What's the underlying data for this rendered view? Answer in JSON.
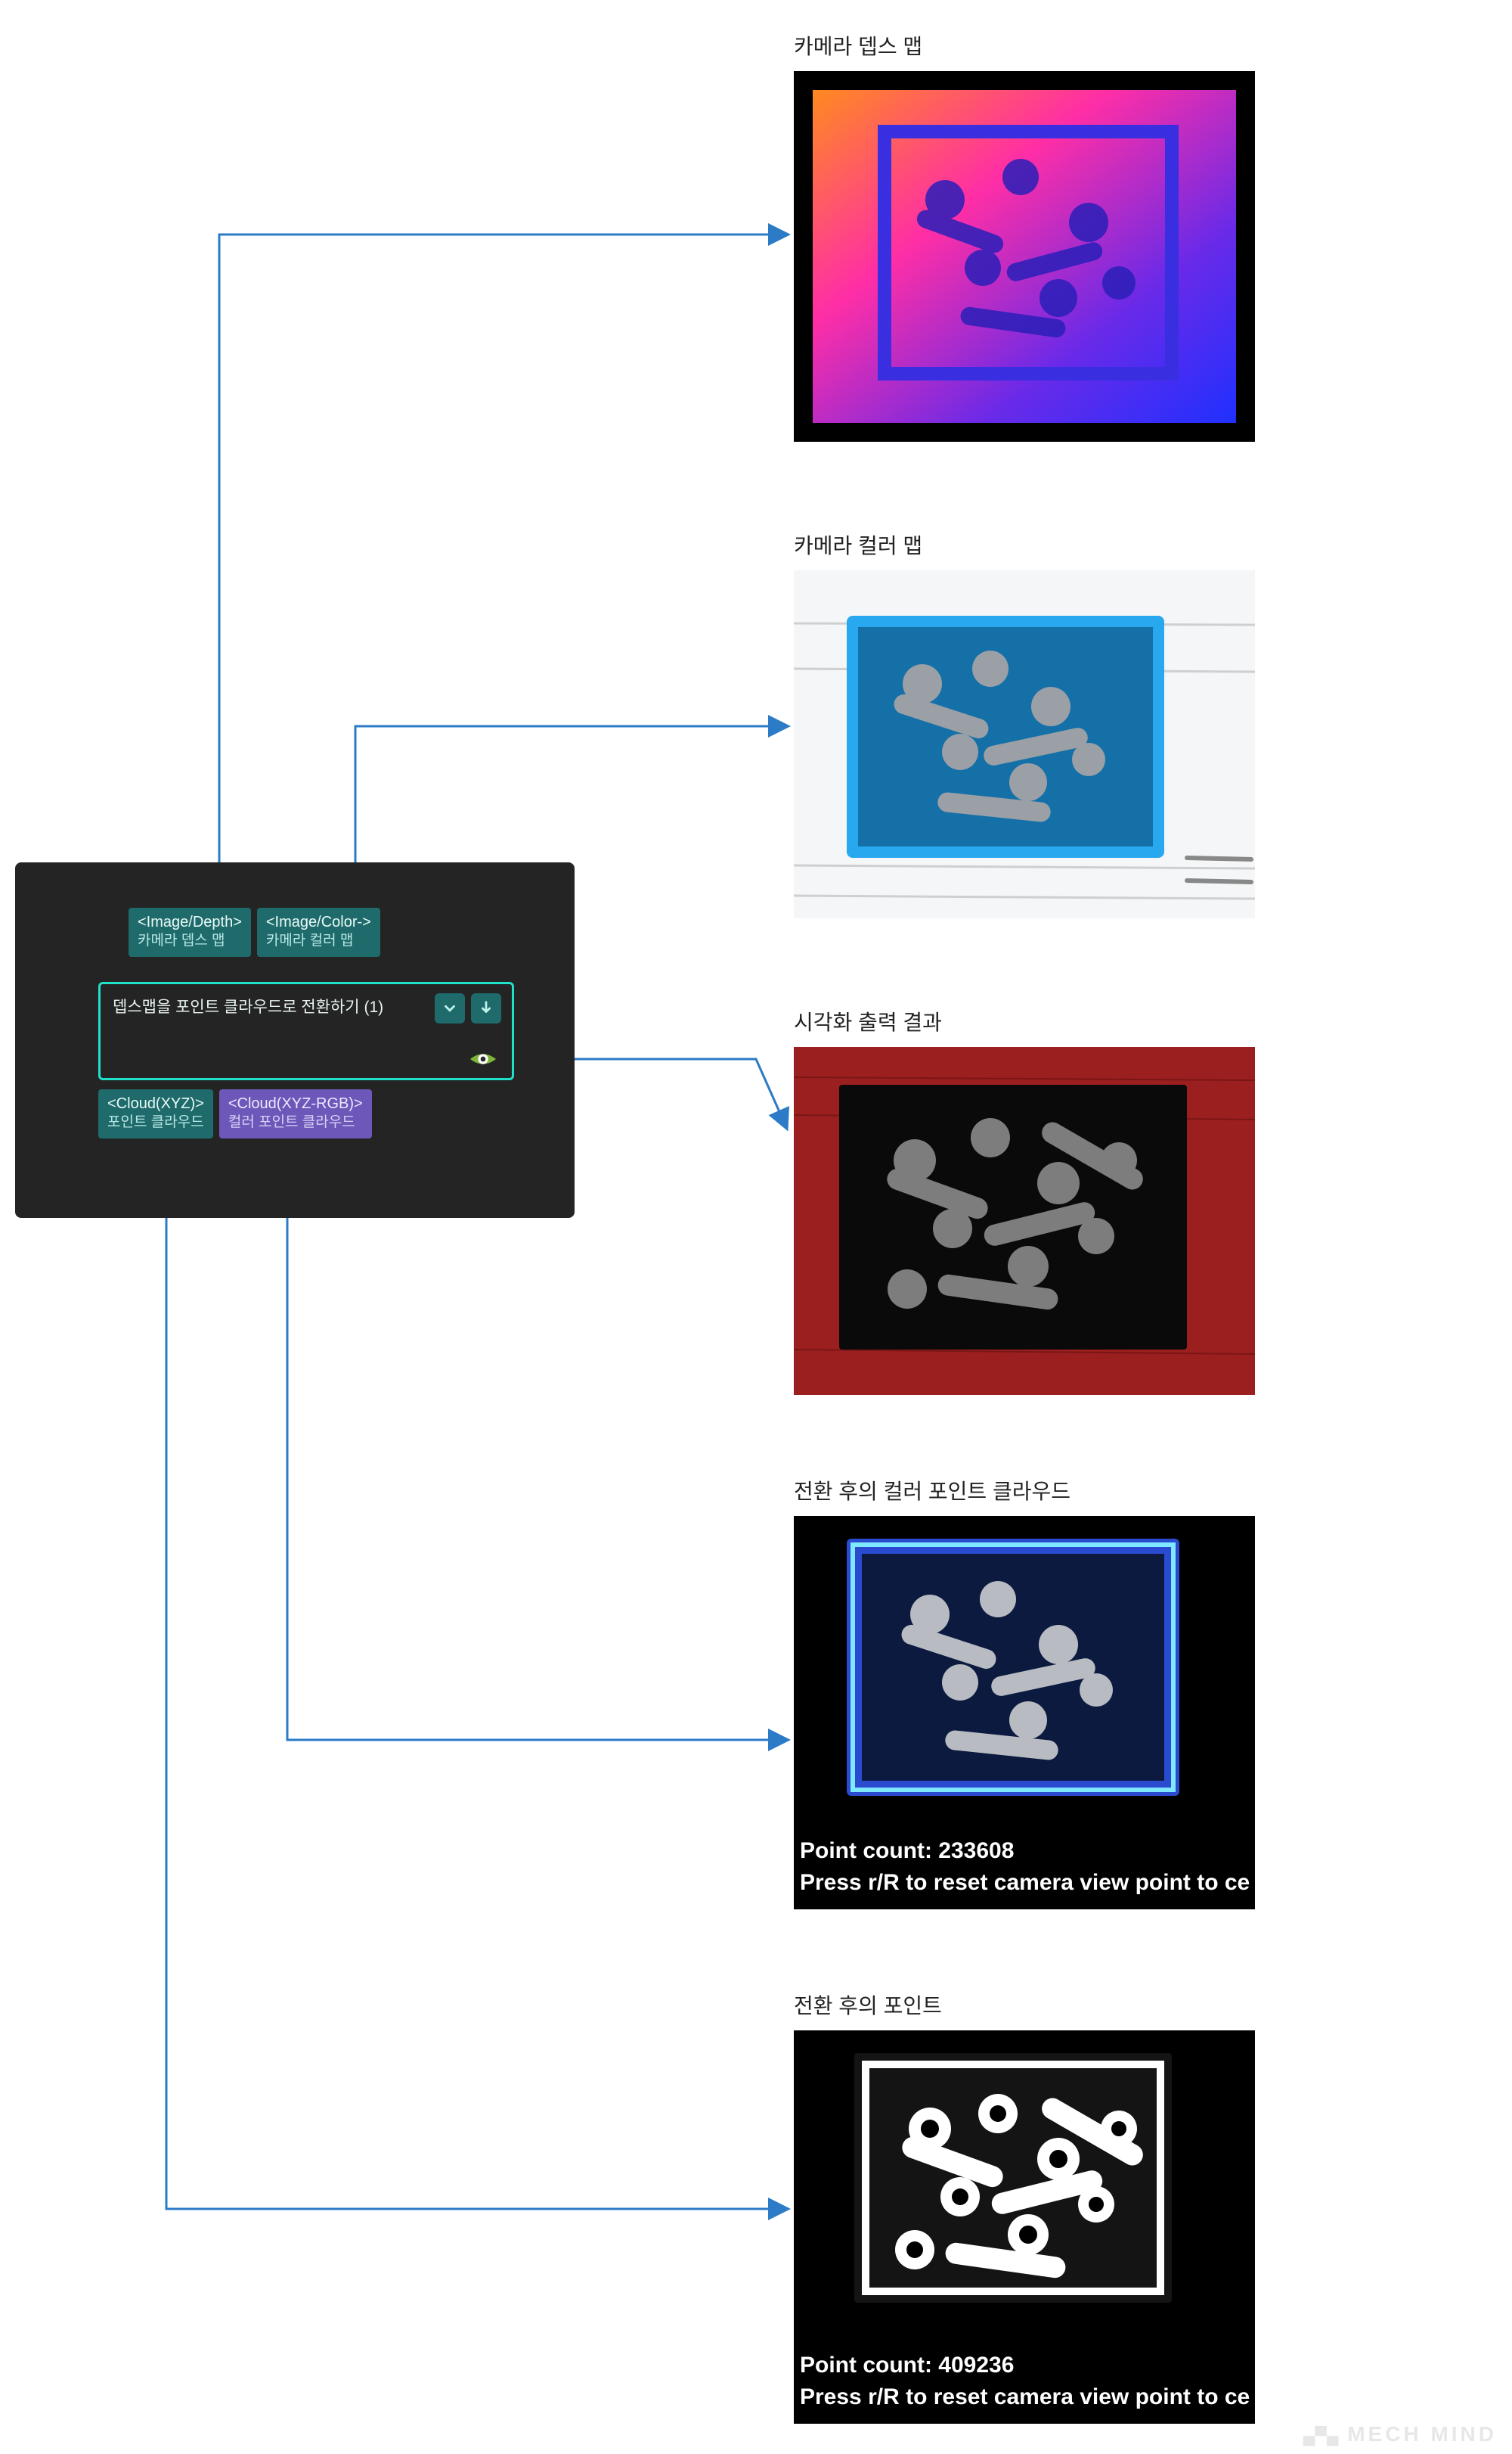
{
  "node": {
    "input_ports": [
      {
        "type": "<Image/Depth>",
        "name": "카메라 뎁스 맵"
      },
      {
        "type": "<Image/Color->",
        "name": "카메라 컬러 맵"
      }
    ],
    "title": "뎁스맵을 포인트 클라우드로 전환하기 (1)",
    "output_ports": [
      {
        "type": "<Cloud(XYZ)>",
        "name": "포인트 클라우드"
      },
      {
        "type": "<Cloud(XYZ-RGB)>",
        "name": "컬러 포인트 클라우드"
      }
    ]
  },
  "previews": {
    "depth": {
      "label": "카메라 뎁스 맵"
    },
    "color": {
      "label": "카메라 컬러 맵"
    },
    "vis": {
      "label": "시각화 출력 결과"
    },
    "rgbcloud": {
      "label": "전환 후의 컬러 포인트 클라우드",
      "point_count_label": "Point count: 233608",
      "hint": "Press r/R to reset camera view point to ce"
    },
    "cloud": {
      "label": "전환 후의 포인트",
      "point_count_label": "Point count: 409236",
      "hint": "Press r/R to reset camera view point to ce"
    }
  },
  "watermark": "MECH MIND",
  "colors": {
    "teal_port": "#1f6b6b",
    "purple_port": "#6d58b9",
    "node_border": "#1fe0c8",
    "connector": "#2b7bc7"
  }
}
